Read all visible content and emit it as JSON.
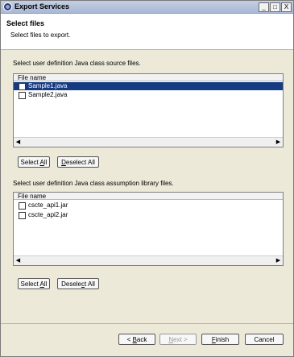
{
  "window": {
    "title": "Export Services",
    "controls": {
      "minimize": "_",
      "maximize": "□",
      "close": "X"
    }
  },
  "header": {
    "title": "Select files",
    "subtitle": "Select files to export."
  },
  "source_section": {
    "label": "Select user definition Java class source files.",
    "column_header": "File name",
    "files": [
      {
        "name": "Sample1.java",
        "selected": true
      },
      {
        "name": "Sample2.java",
        "selected": false
      }
    ],
    "select_all": {
      "prefix": "Select ",
      "mnemonic": "A",
      "suffix": "ll"
    },
    "deselect_all": {
      "prefix": "",
      "mnemonic": "D",
      "suffix": "eselect All"
    }
  },
  "library_section": {
    "label": "Select user definition Java class assumption library files.",
    "column_header": "File name",
    "files": [
      {
        "name": "cscte_api1.jar",
        "selected": false
      },
      {
        "name": "cscte_api2.jar",
        "selected": false
      }
    ],
    "select_all": {
      "prefix": "Select ",
      "mnemonic": "A",
      "suffix": "ll"
    },
    "deselect_all": {
      "prefix": "Desele",
      "mnemonic": "c",
      "suffix": "t All"
    }
  },
  "footer": {
    "back": {
      "arrow": "< ",
      "mnemonic": "B",
      "suffix": "ack"
    },
    "next": {
      "mnemonic": "N",
      "suffix": "ext >"
    },
    "finish": {
      "mnemonic": "F",
      "suffix": "inish"
    },
    "cancel": "Cancel"
  },
  "scroll_arrows": {
    "left": "◀",
    "right": "▶"
  },
  "colors": {
    "selection": "#163b82",
    "title_bar": "#a8b8d6",
    "dialog_bg": "#ece9d8"
  }
}
